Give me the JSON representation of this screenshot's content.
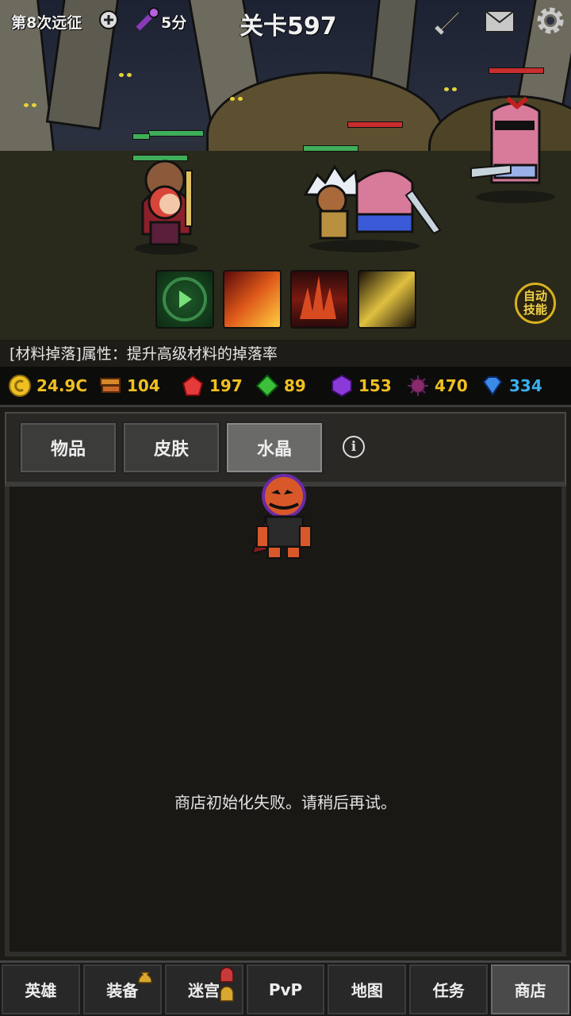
{
  "hud": {
    "expedition": "第8次远征",
    "key_time": "5分",
    "stage_title": "关卡597"
  },
  "skills": {
    "auto_label_line1": "自动",
    "auto_label_line2": "技能"
  },
  "info_line": "[材料掉落]属性：提升高级材料的掉落率",
  "currency": {
    "gold": "24.9C",
    "books": "104",
    "ruby": "197",
    "emerald": "89",
    "amethyst": "153",
    "dark_gem": "470",
    "diamond": "334"
  },
  "shop": {
    "tabs": [
      "物品",
      "皮肤",
      "水晶"
    ],
    "active_tab": "水晶",
    "info_icon": "i",
    "error_message": "商店初始化失败。请稍后再试。"
  },
  "bottom_nav": [
    "英雄",
    "装备",
    "迷宫",
    "PvP",
    "地图",
    "任务",
    "商店"
  ],
  "active_nav": "商店",
  "colors": {
    "gold": "#f0c020",
    "ruby": "#e43a3a",
    "emerald": "#3cc03c",
    "amethyst": "#8a3ad8",
    "diamond": "#3a8ae8",
    "hp_green": "#3fae5a",
    "hp_red": "#c92d2d"
  }
}
